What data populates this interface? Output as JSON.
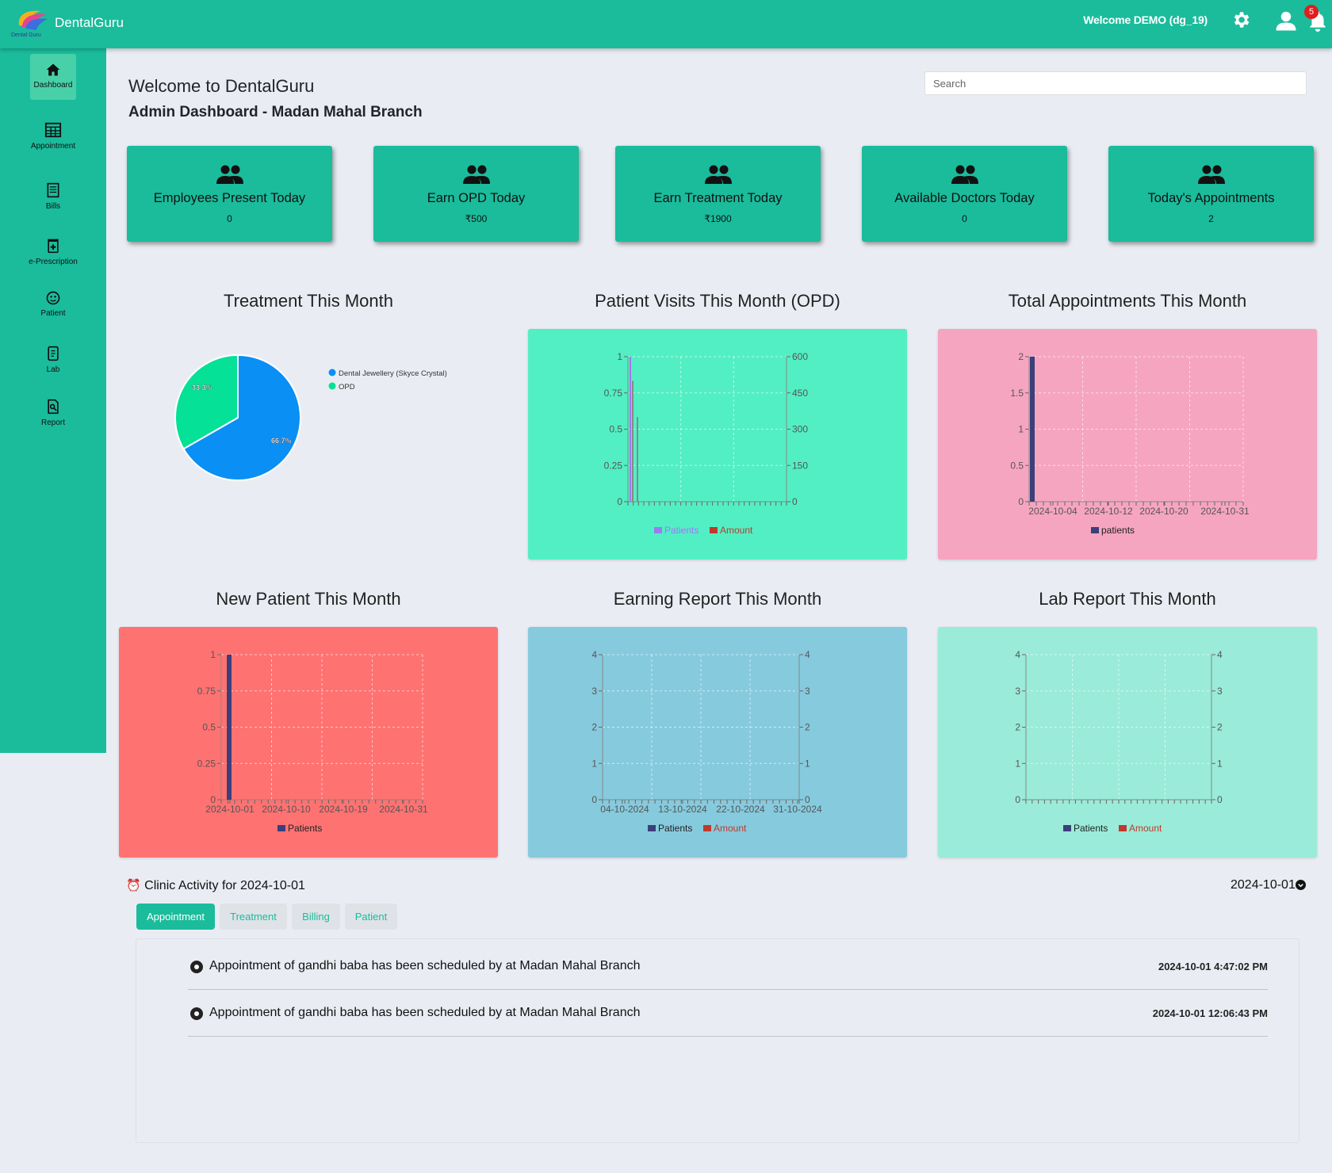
{
  "topbar": {
    "title": "DentalGuru",
    "logo_text": "Dental Guru",
    "welcome": "Welcome DEMO (dg_19)",
    "notification_count": "5"
  },
  "sidebar": {
    "items": [
      {
        "label": "Dashboard",
        "icon": "home-icon"
      },
      {
        "label": "Appointment",
        "icon": "table-icon"
      },
      {
        "label": "Bills",
        "icon": "receipt-icon"
      },
      {
        "label": "e-Prescription",
        "icon": "prescription-icon"
      },
      {
        "label": "Patient",
        "icon": "patient-icon"
      },
      {
        "label": "Lab",
        "icon": "lab-icon"
      },
      {
        "label": "Report",
        "icon": "report-icon"
      }
    ]
  },
  "header": {
    "welcome": "Welcome to DentalGuru",
    "subtitle": "Admin Dashboard - Madan Mahal Branch",
    "search_placeholder": "Search"
  },
  "stats": [
    {
      "label": "Employees Present Today",
      "value": "0"
    },
    {
      "label": "Earn OPD Today",
      "value": "₹500"
    },
    {
      "label": "Earn Treatment Today",
      "value": "₹1900"
    },
    {
      "label": "Available Doctors Today",
      "value": "0"
    },
    {
      "label": "Today's Appointments",
      "value": "2"
    }
  ],
  "colors": {
    "primary": "#1abc9c",
    "opd_panel": "#52efc4",
    "appointments_panel": "#f6a5c0",
    "new_patient_panel": "#ff7272",
    "earning_panel": "#86cade",
    "lab_panel": "#9aebd9",
    "series_patients": "#3b3f7a",
    "series_amount": "#c0392b"
  },
  "chart_data": [
    {
      "type": "pie",
      "title": "Treatment This Month",
      "labels": [
        "Dental Jewellery (Skyce Crystal)",
        "OPD"
      ],
      "values": [
        66.7,
        33.3
      ],
      "value_labels": [
        "66.7%",
        "33.3%"
      ],
      "colors": [
        "#0a8ff5",
        "#05e197"
      ],
      "legend": "right"
    },
    {
      "type": "bar",
      "title": "Patient Visits This Month (OPD)",
      "y_ticks": [
        "0",
        "0.25",
        "0.5",
        "0.75",
        "1"
      ],
      "y2_ticks": [
        "0",
        "150",
        "300",
        "450",
        "600"
      ],
      "ylim": [
        0,
        1
      ],
      "y2lim": [
        0,
        600
      ],
      "series": [
        {
          "name": "Patients",
          "values": [
            1
          ]
        },
        {
          "name": "Amount",
          "values": [
            500,
            350
          ]
        }
      ],
      "legend": "bottom"
    },
    {
      "type": "bar",
      "title": "Total Appointments This Month",
      "x_ticks": [
        "2024-10-04",
        "2024-10-12",
        "2024-10-20",
        "2024-10-31"
      ],
      "y_ticks": [
        "0",
        "0.5",
        "1",
        "1.5",
        "2"
      ],
      "ylim": [
        0,
        2
      ],
      "series": [
        {
          "name": "patients",
          "x": [
            "2024-10-01"
          ],
          "values": [
            2
          ]
        }
      ],
      "legend": "bottom"
    },
    {
      "type": "bar",
      "title": "New Patient This Month",
      "x_ticks": [
        "2024-10-01",
        "2024-10-10",
        "2024-10-19",
        "2024-10-31"
      ],
      "y_ticks": [
        "0",
        "0.25",
        "0.5",
        "0.75",
        "1"
      ],
      "ylim": [
        0,
        1
      ],
      "series": [
        {
          "name": "Patients",
          "x": [
            "2024-10-01"
          ],
          "values": [
            1
          ]
        }
      ],
      "legend": "bottom"
    },
    {
      "type": "bar",
      "title": "Earning Report This Month",
      "x_ticks": [
        "04-10-2024",
        "13-10-2024",
        "22-10-2024",
        "31-10-2024"
      ],
      "y_ticks": [
        "0",
        "1",
        "2",
        "3",
        "4"
      ],
      "y2_ticks": [
        "0",
        "1",
        "2",
        "3",
        "4"
      ],
      "ylim": [
        0,
        4
      ],
      "series": [
        {
          "name": "Patients",
          "values": []
        },
        {
          "name": "Amount",
          "values": []
        }
      ],
      "legend": "bottom"
    },
    {
      "type": "bar",
      "title": "Lab Report This Month",
      "y_ticks": [
        "0",
        "1",
        "2",
        "3",
        "4"
      ],
      "y2_ticks": [
        "0",
        "1",
        "2",
        "3",
        "4"
      ],
      "ylim": [
        0,
        4
      ],
      "series": [
        {
          "name": "Patients",
          "values": []
        },
        {
          "name": "Amount",
          "values": []
        }
      ],
      "legend": "bottom"
    }
  ],
  "activity": {
    "title": "Clinic Activity for 2024-10-01",
    "date": "2024-10-01",
    "tabs": [
      "Appointment",
      "Treatment",
      "Billing",
      "Patient"
    ],
    "active_tab": "Appointment",
    "items": [
      {
        "message": "Appointment of gandhi baba has been scheduled by at Madan Mahal Branch",
        "time": "2024-10-01 4:47:02 PM"
      },
      {
        "message": "Appointment of gandhi baba has been scheduled by at Madan Mahal Branch",
        "time": "2024-10-01 12:06:43 PM"
      }
    ]
  }
}
